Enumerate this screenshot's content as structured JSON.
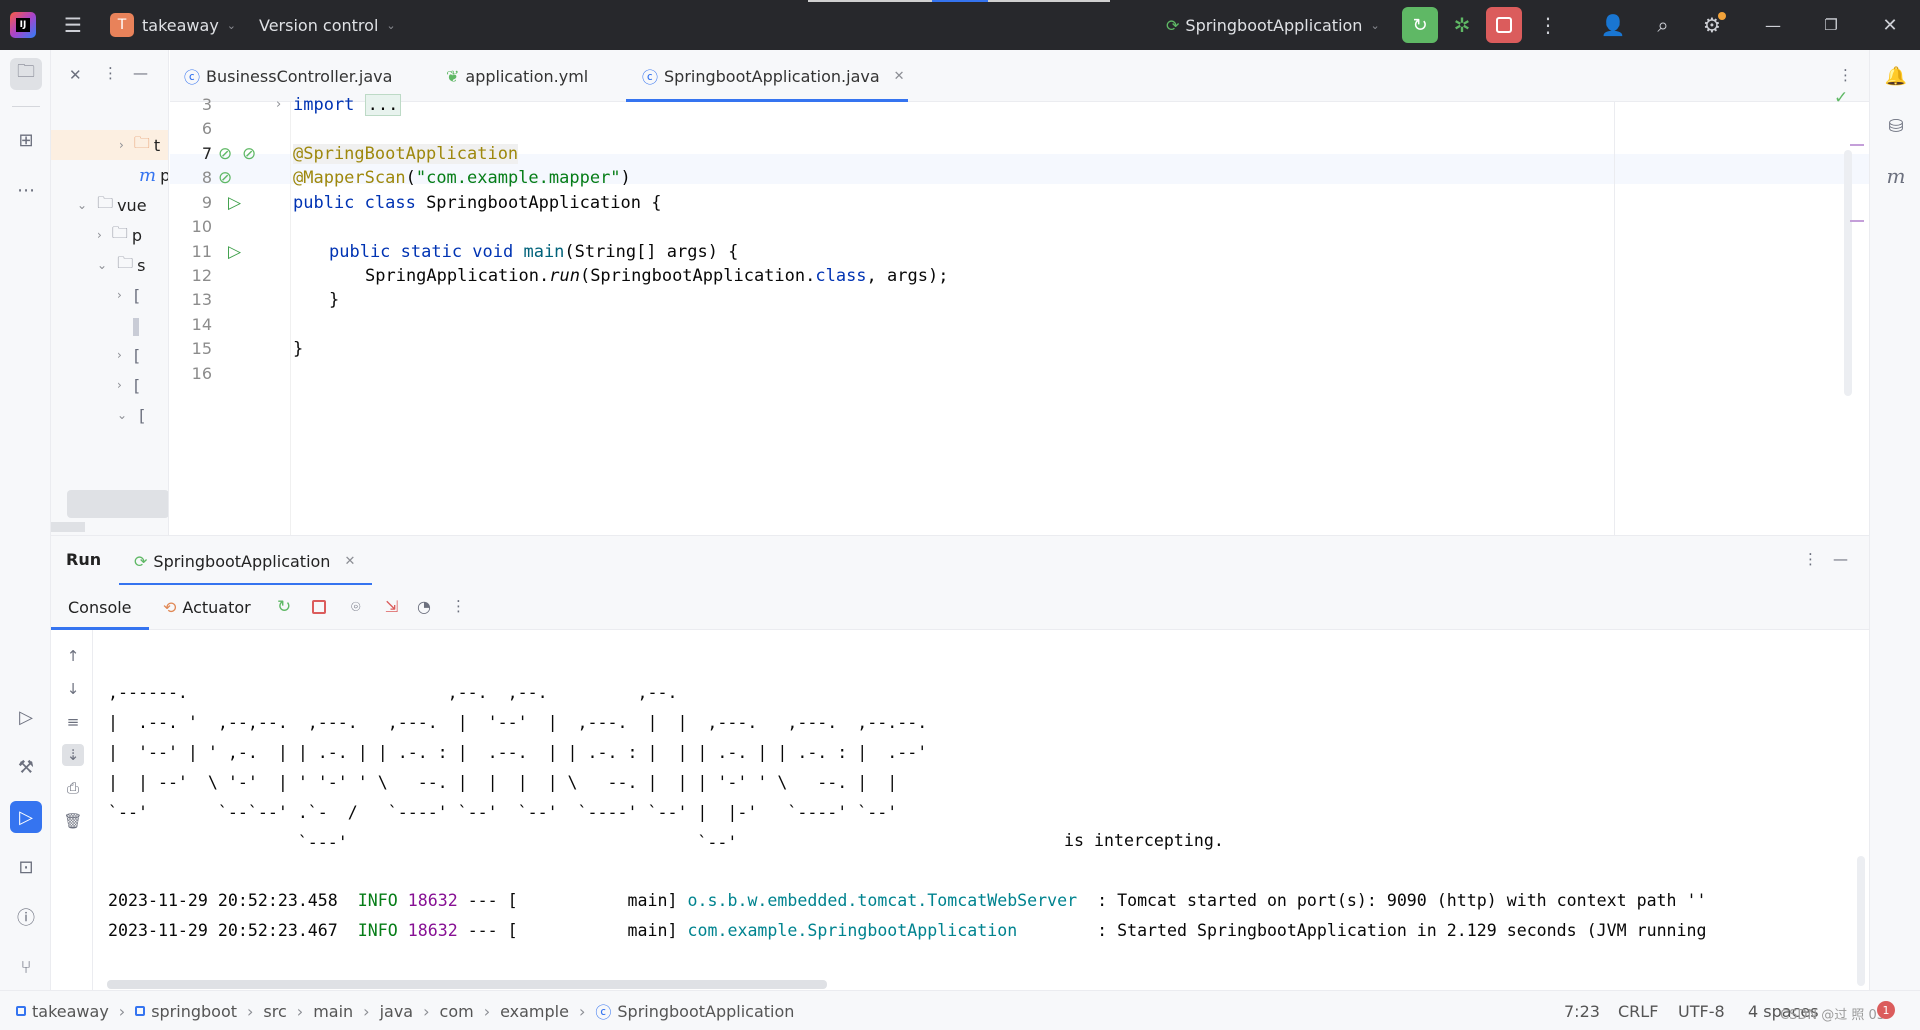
{
  "titlebar": {
    "project_initial": "T",
    "project_name": "takeaway",
    "vcs": "Version control",
    "run_config": "SpringbootApplication"
  },
  "project_tree": {
    "item_t": "t",
    "item_m": "p",
    "item_vue": "vue",
    "item_p": "p",
    "item_s": "s",
    "item_b1": "[",
    "item_b2": "[",
    "item_b3": "["
  },
  "tabs": [
    {
      "label": "BusinessController.java"
    },
    {
      "label": "application.yml"
    },
    {
      "label": "SpringbootApplication.java"
    }
  ],
  "code": {
    "line_numbers": [
      "3",
      "6",
      "7",
      "8",
      "9",
      "10",
      "11",
      "12",
      "13",
      "14",
      "15",
      "16"
    ],
    "import_kw": "import",
    "import_fold": "...",
    "ann1": "@SpringBootApplication",
    "ann2": "@MapperScan",
    "ann2_open": "(",
    "ann2_str": "\"com.example.mapper\"",
    "ann2_close": ")",
    "l9_kw": "public class",
    "l9_rest": " SpringbootApplication {",
    "l11_kw": "public static void",
    "l11_fn": " main",
    "l11_rest": "(String[] args) {",
    "l12_a": "SpringApplication.",
    "l12_run": "run",
    "l12_b": "(SpringbootApplication.",
    "l12_cls": "class",
    "l12_c": ", args);",
    "l13": "}",
    "l15": "}"
  },
  "run_panel": {
    "run_label": "Run",
    "run_tab": "SpringbootApplication",
    "console_tab": "Console",
    "actuator_tab": "Actuator"
  },
  "console": {
    "ascii": ",------.                          ,--.  ,--.         ,--.\n|  .--. '  ,--,--.  ,---.   ,---.  |  '--'  |  ,---.  |  |  ,---.   ,---.  ,--.--.\n|  '--' | ' ,-.  | | .-. | | .-. : |  .--.  | | .-. : |  | | .-. | | .-. : |  .--'\n|  | --'  \\ '-'  | ' '-' ' \\   --. |  |  |  | \\   --. |  | | '-' ' \\   --. |  |\n`--'       `--`--' .`-  /   `----' `--'  `--'  `----' `--' |  |-'   `----' `--'\n                   `---'                                   `--'",
    "intercept": "is intercepting.",
    "logs": [
      {
        "ts": "2023-11-29 20:52:23.458",
        "level": "INFO",
        "pid": "18632",
        "sep": "--- [",
        "thread": "           main]",
        "logger": "o.s.b.w.embedded.tomcat.TomcatWebServer",
        "msg": "  : Tomcat started on port(s): 9090 (http) with context path ''"
      },
      {
        "ts": "2023-11-29 20:52:23.467",
        "level": "INFO",
        "pid": "18632",
        "sep": "--- [",
        "thread": "           main]",
        "logger": "com.example.SpringbootApplication",
        "msg": "        : Started SpringbootApplication in 2.129 seconds (JVM running"
      }
    ]
  },
  "statusbar": {
    "crumbs": [
      "takeaway",
      "springboot",
      "src",
      "main",
      "java",
      "com",
      "example",
      "SpringbootApplication"
    ],
    "position": "7:23",
    "line_sep": "CRLF",
    "encoding": "UTF-8",
    "indent": "4 spaces",
    "watermark": "CSDN @过 照 03",
    "notif_count": "1"
  },
  "colors": {
    "accent": "#3574f0",
    "run_green": "#5fb865",
    "stop_red": "#db5c5c"
  }
}
